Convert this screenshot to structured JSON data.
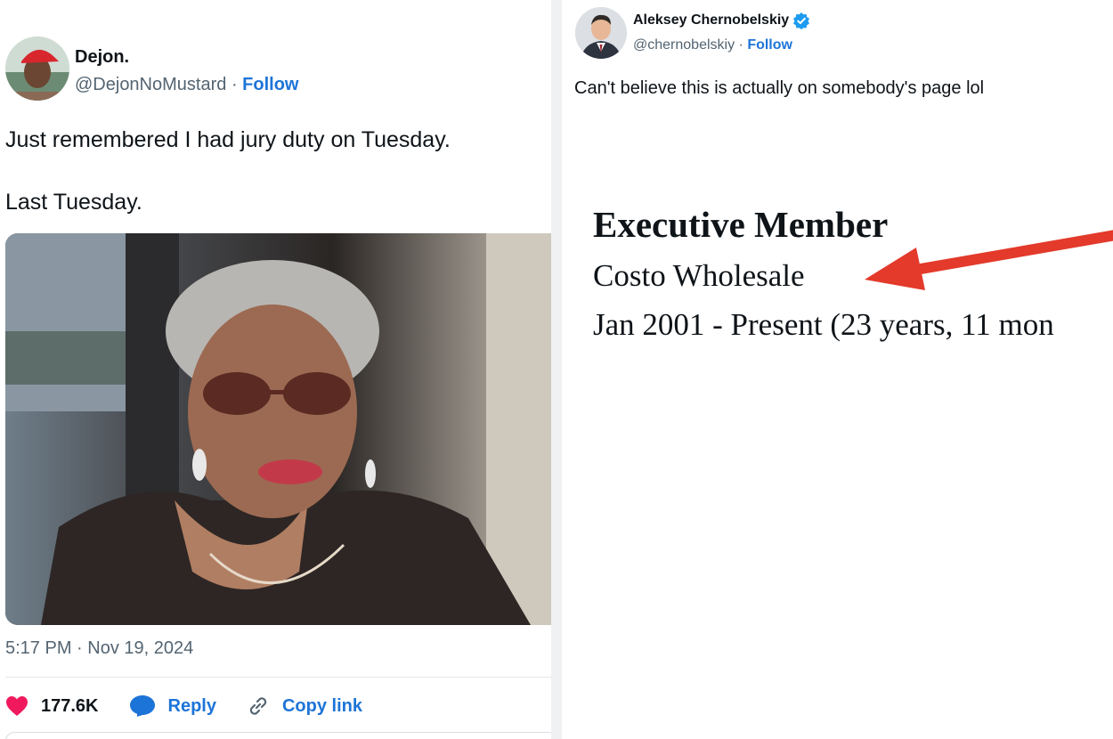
{
  "left_tweet": {
    "author_name": "Dejon.",
    "handle": "@DejonNoMustard",
    "separator": "·",
    "follow_label": "Follow",
    "text_lines": [
      "Just remembered I had jury duty on Tuesday.",
      "Last Tuesday."
    ],
    "timestamp": "5:17 PM · Nov 19, 2024",
    "actions": {
      "likes": "177.6K",
      "reply_label": "Reply",
      "copy_label": "Copy link"
    },
    "icons": [
      "heart-icon",
      "reply-icon",
      "link-icon"
    ]
  },
  "right_tweet": {
    "author_name": "Aleksey Chernobelskiy",
    "verified": true,
    "handle": "@chernobelskiy",
    "separator": "·",
    "follow_label": "Follow",
    "text": "Can't believe this is actually on somebody's page lol",
    "screenshot": {
      "title": "Executive Member",
      "company": "Costo Wholesale",
      "dates": "Jan 2001 - Present (23 years, 11 mon"
    }
  },
  "colors": {
    "accent": "#1d74d8",
    "heart": "#f0195e",
    "arrow": "#e33a2b",
    "divider": "#f0f1f3"
  }
}
